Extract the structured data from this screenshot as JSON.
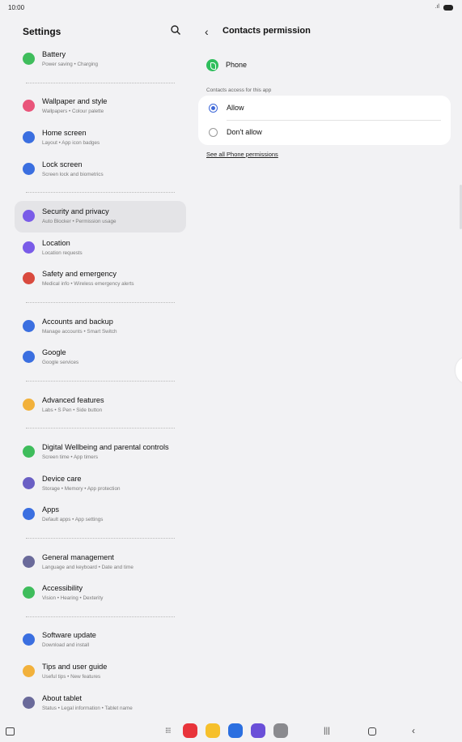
{
  "status_bar": {
    "time": "10:00",
    "signal": ".ıl"
  },
  "settings": {
    "title": "Settings",
    "groups": [
      [
        {
          "title": "Battery",
          "subtitle": "Power saving  •  Charging",
          "icon": "battery-icon",
          "color": "#3fbd5c"
        }
      ],
      [
        {
          "title": "Wallpaper and style",
          "subtitle": "Wallpapers  •  Colour palette",
          "icon": "wallpaper-icon",
          "color": "#e9557a"
        },
        {
          "title": "Home screen",
          "subtitle": "Layout  •  App icon badges",
          "icon": "home-icon",
          "color": "#3b6fe0"
        },
        {
          "title": "Lock screen",
          "subtitle": "Screen lock and biometrics",
          "icon": "lock-icon",
          "color": "#3b6fe0"
        }
      ],
      [
        {
          "title": "Security and privacy",
          "subtitle": "Auto Blocker  •  Permission usage",
          "icon": "shield-icon",
          "color": "#7a5ce8",
          "active": true
        },
        {
          "title": "Location",
          "subtitle": "Location requests",
          "icon": "location-icon",
          "color": "#7a5ce8"
        },
        {
          "title": "Safety and emergency",
          "subtitle": "Medical info  •  Wireless emergency alerts",
          "icon": "emergency-icon",
          "color": "#d94a3e"
        }
      ],
      [
        {
          "title": "Accounts and backup",
          "subtitle": "Manage accounts  •  Smart Switch",
          "icon": "sync-icon",
          "color": "#3b6fe0"
        },
        {
          "title": "Google",
          "subtitle": "Google services",
          "icon": "google-icon",
          "color": "#3b6fe0"
        }
      ],
      [
        {
          "title": "Advanced features",
          "subtitle": "Labs  •  S Pen  •  Side button",
          "icon": "star-icon",
          "color": "#f2b13b"
        }
      ],
      [
        {
          "title": "Digital Wellbeing and parental controls",
          "subtitle": "Screen time  •  App timers",
          "icon": "wellbeing-icon",
          "color": "#3fbd5c"
        },
        {
          "title": "Device care",
          "subtitle": "Storage  •  Memory  •  App protection",
          "icon": "device-care-icon",
          "color": "#6a5fc4"
        },
        {
          "title": "Apps",
          "subtitle": "Default apps  •  App settings",
          "icon": "apps-icon",
          "color": "#3b6fe0"
        }
      ],
      [
        {
          "title": "General management",
          "subtitle": "Language and keyboard  •  Date and time",
          "icon": "sliders-icon",
          "color": "#6a6a9a"
        },
        {
          "title": "Accessibility",
          "subtitle": "Vision  •  Hearing  •  Dexterity",
          "icon": "accessibility-icon",
          "color": "#3fbd5c"
        }
      ],
      [
        {
          "title": "Software update",
          "subtitle": "Download and install",
          "icon": "update-icon",
          "color": "#3b6fe0"
        },
        {
          "title": "Tips and user guide",
          "subtitle": "Useful tips  •  New features",
          "icon": "bulb-icon",
          "color": "#f2b13b"
        },
        {
          "title": "About tablet",
          "subtitle": "Status  •  Legal information  •  Tablet name",
          "icon": "info-icon",
          "color": "#6a6a9a"
        }
      ]
    ]
  },
  "detail": {
    "title": "Contacts permission",
    "app_name": "Phone",
    "section_label": "Contacts access for this app",
    "options": [
      {
        "label": "Allow",
        "selected": true
      },
      {
        "label": "Don't allow",
        "selected": false
      }
    ],
    "link": "See all Phone permissions"
  },
  "nav_bar": {
    "dock_apps": [
      {
        "name": "app-red-icon",
        "color": "#e8343b"
      },
      {
        "name": "app-folder-icon",
        "color": "#f6c02b"
      },
      {
        "name": "app-chat-icon",
        "color": "#2b6fe0"
      },
      {
        "name": "app-internet-icon",
        "color": "#6a4fd8"
      },
      {
        "name": "app-camera-icon",
        "color": "#8a8a8e"
      }
    ],
    "recents_glyph": "|||",
    "back_glyph": "‹"
  }
}
